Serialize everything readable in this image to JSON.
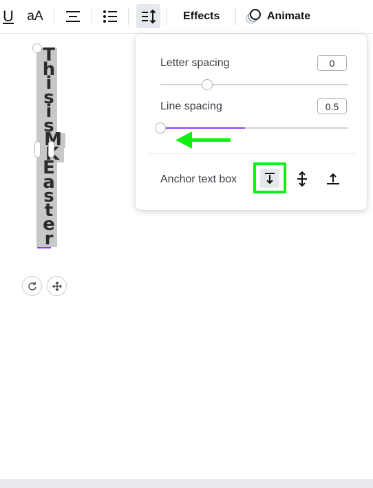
{
  "toolbar": {
    "underline_label": "U",
    "case_label": "aA",
    "effects_label": "Effects",
    "animate_label": "Animate",
    "icons": [
      "underline-icon",
      "text-case-icon",
      "align-center-icon",
      "list-icon",
      "spacing-icon",
      "animate-icon"
    ]
  },
  "canvas": {
    "vertical_text_chars": [
      "T",
      "h",
      "i",
      "s",
      "i",
      "s",
      "M",
      "K",
      "E",
      "a",
      "s",
      "t",
      "e",
      "r"
    ]
  },
  "panel": {
    "letter_spacing": {
      "label": "Letter spacing",
      "value": "0",
      "level": 0.25
    },
    "line_spacing": {
      "label": "Line spacing",
      "value": "0.5",
      "level": 0.0,
      "fill": 0.45
    },
    "anchor": {
      "label": "Anchor text box",
      "selected": "top"
    }
  },
  "colors": {
    "accent": "#8b3dff",
    "highlight_green": "#12f012",
    "toolbar_active_bg": "#e5e8ec"
  }
}
